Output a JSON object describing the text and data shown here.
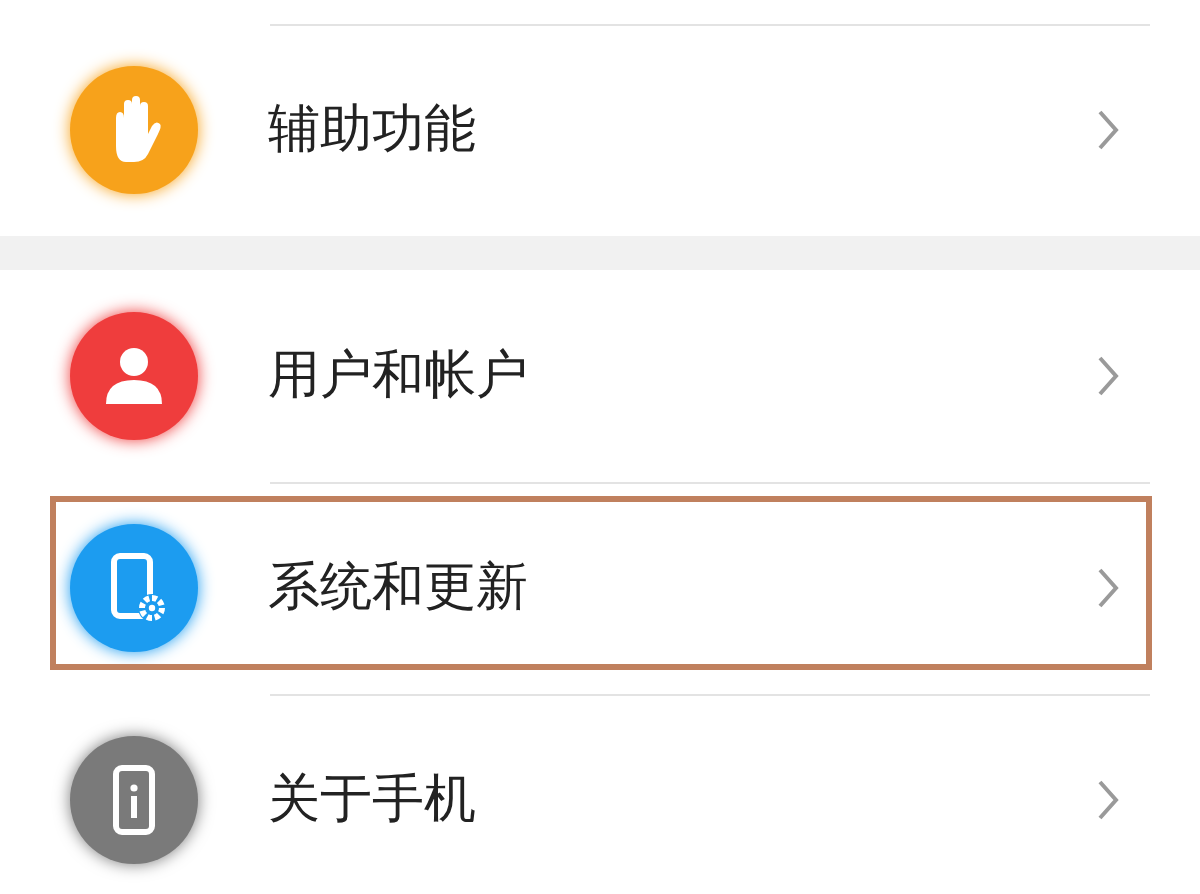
{
  "groups": [
    {
      "items": [
        {
          "kind": "hand",
          "label": "辅助功能",
          "color": "#f7a21b",
          "highlighted": false
        }
      ]
    },
    {
      "items": [
        {
          "kind": "person",
          "label": "用户和帐户",
          "color": "#ef3d3d",
          "highlighted": false
        },
        {
          "kind": "phone-gear",
          "label": "系统和更新",
          "color": "#1c9cf0",
          "highlighted": true
        },
        {
          "kind": "phone-info",
          "label": "关于手机",
          "color": "#7a7a7a",
          "highlighted": false
        }
      ]
    }
  ]
}
